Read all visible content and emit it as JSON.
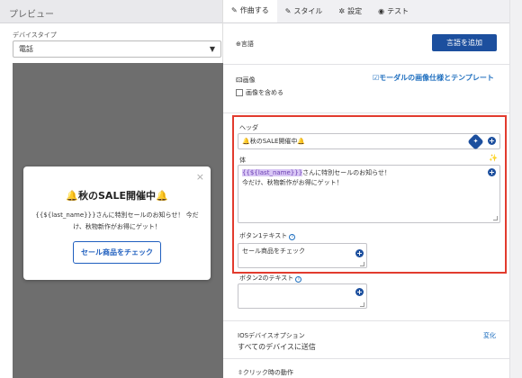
{
  "preview": {
    "header": "プレビュー",
    "device_label": "デバイスタイプ",
    "device_value": "電話",
    "modal": {
      "title": "🔔秋のSALE開催中🔔",
      "body": "{{${last_name}}}さんに特別セールのお知らせ！ 今だけ、秋物新作がお得にゲット！",
      "button": "セール商品をチェック",
      "close": "×"
    }
  },
  "tabs": [
    {
      "icon": "✎",
      "label": "作曲する"
    },
    {
      "icon": "✎",
      "label": "スタイル"
    },
    {
      "icon": "✲",
      "label": "設定"
    },
    {
      "icon": "◉",
      "label": "テスト"
    }
  ],
  "language": {
    "label": "⊕言語",
    "button": "言語を追加"
  },
  "image": {
    "label": "🖾画像",
    "link": "☑モーダルの画像仕様とテンプレート",
    "checkbox": "画像を含める"
  },
  "header_field": {
    "label": "ヘッダ",
    "value": "🔔秋のSALE開催中🔔"
  },
  "body_field": {
    "label": "体",
    "var": "{{${last_name}}}",
    "line1_rest": "さんに特別セールのお知らせ！",
    "line2": "今だけ、秋物新作がお得にゲット！"
  },
  "button1": {
    "label": "ボタン1テキスト",
    "value": "セール商品をチェック"
  },
  "button2": {
    "label": "ボタン2のテキスト"
  },
  "ios": {
    "title": "IOSデバイスオプション",
    "value": "すべてのデバイスに送信",
    "change": "変化"
  },
  "click": {
    "label": "⇳クリック時の動作"
  },
  "colors": {
    "accent": "#1c4f9e",
    "highlight_border": "#e23b2e"
  }
}
